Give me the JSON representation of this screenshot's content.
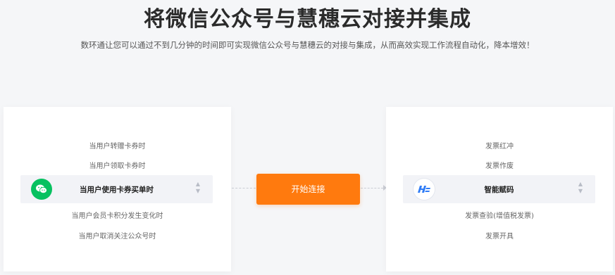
{
  "header": {
    "title": "将微信公众号与慧穗云对接并集成",
    "subtitle": "数环通让您可以通过不到几分钟的时间即可实现微信公众号与慧穗云的对接与集成，从而高效实现工作流程自动化，降本增效！"
  },
  "left_panel": {
    "app": "微信公众号",
    "icon": "wechat-icon",
    "options_above": [
      "当用户转赠卡券时",
      "当用户领取卡券时"
    ],
    "selected": "当用户使用卡券买单时",
    "options_below": [
      "当用户会员卡积分发生变化时",
      "当用户取消关注公众号时"
    ]
  },
  "right_panel": {
    "app": "慧穗云",
    "icon": "huisuiyun-logo-icon",
    "options_above": [
      "发票红冲",
      "发票作废"
    ],
    "selected": "智能赋码",
    "options_below": [
      "发票查验(增值税发票)",
      "发票开具"
    ]
  },
  "start_button": {
    "label": "开始连接"
  },
  "colors": {
    "accent": "#ff7a0e",
    "wechat": "#07c160",
    "logo_blue": "#2f7cf6"
  }
}
